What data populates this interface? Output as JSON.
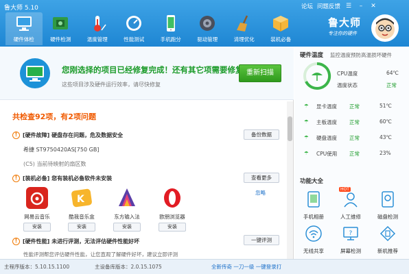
{
  "app": {
    "title": "鲁大师 5.10",
    "links": [
      "论坛",
      "问题反馈"
    ],
    "brand": "鲁大师",
    "slogan": "专注你的硬件"
  },
  "nav": [
    {
      "label": "硬件体检",
      "icon": "monitor-icon",
      "active": true
    },
    {
      "label": "硬件检测",
      "icon": "chip-icon"
    },
    {
      "label": "温度管理",
      "icon": "thermometer-icon"
    },
    {
      "label": "性能测试",
      "icon": "gauge-icon"
    },
    {
      "label": "手机跑分",
      "icon": "phone-icon"
    },
    {
      "label": "驱动管理",
      "icon": "driver-icon"
    },
    {
      "label": "清理优化",
      "icon": "broom-icon"
    },
    {
      "label": "装机必备",
      "icon": "package-icon"
    }
  ],
  "banner": {
    "headline": "您刚选择的项目已经修复完成！还有其它项需要修复！",
    "sub": "这些项目涉及硬件运行效率，请尽快修复",
    "rescan": "重新扫描"
  },
  "summary": "共检查92项，有2项问题",
  "problems": [
    {
      "title": "[硬件故障] 硬盘存在问题，危及数据安全",
      "detail": "希捷 ST9750420AS[750 GB]",
      "detail2": "(C5) 当前待映射的扇区数",
      "button": "备份数据"
    },
    {
      "title": "[装机必备] 您有装机必备软件未安装",
      "button": "查看更多",
      "ignore": "忽略"
    },
    {
      "title": "[硬件性能] 未进行评测，无法评估硬件性能好坏",
      "detail": "性能评测帮您评估硬件性能，让您直观了解硬件好坏，建议立即评测",
      "button": "一键评测"
    }
  ],
  "software": [
    {
      "name": "网易云音乐",
      "button": "安装",
      "color": "#d9251d"
    },
    {
      "name": "酷我音乐盒",
      "button": "安装",
      "color": "#f7b52c"
    },
    {
      "name": "东方输入法",
      "button": "安装",
      "color": "#5a3ea8"
    },
    {
      "name": "欧朋浏览器",
      "button": "安装",
      "color": "#e21c24"
    }
  ],
  "temps": {
    "title": "硬件温度",
    "desc": "监控温度预防高温损坏硬件",
    "cpu_label": "CPU温度",
    "cpu_value": "64℃",
    "state_label": "温度状态",
    "state_value": "正常",
    "rows": [
      {
        "label": "显卡温度",
        "status": "正常",
        "value": "51℃"
      },
      {
        "label": "主板温度",
        "status": "正常",
        "value": "60℃"
      },
      {
        "label": "硬盘温度",
        "status": "正常",
        "value": "43℃"
      },
      {
        "label": "CPU使用",
        "status": "正常",
        "value": "23%"
      }
    ]
  },
  "tools": {
    "title": "功能大全",
    "hot": "HOT",
    "items": [
      {
        "label": "手机相册",
        "icon": "photo-album-icon"
      },
      {
        "label": "人工维修",
        "icon": "repair-person-icon"
      },
      {
        "label": "磁盘检测",
        "icon": "disk-check-icon"
      },
      {
        "label": "无线共享",
        "icon": "wifi-share-icon"
      },
      {
        "label": "屏幕检测",
        "icon": "screen-check-icon"
      },
      {
        "label": "新机推荐",
        "icon": "new-phone-icon"
      }
    ]
  },
  "status": {
    "main_version": "主程序版本：5.10.15.1100",
    "db_version": "主设备库版本：2.0.15.1075",
    "ad": "全新传奇 一刀一级 一键登录打"
  },
  "colors": {
    "titlebar": "#2793dc",
    "accent_green": "#1c9b2a",
    "warning_orange": "#f05a00",
    "link_blue": "#1a6fc9"
  }
}
